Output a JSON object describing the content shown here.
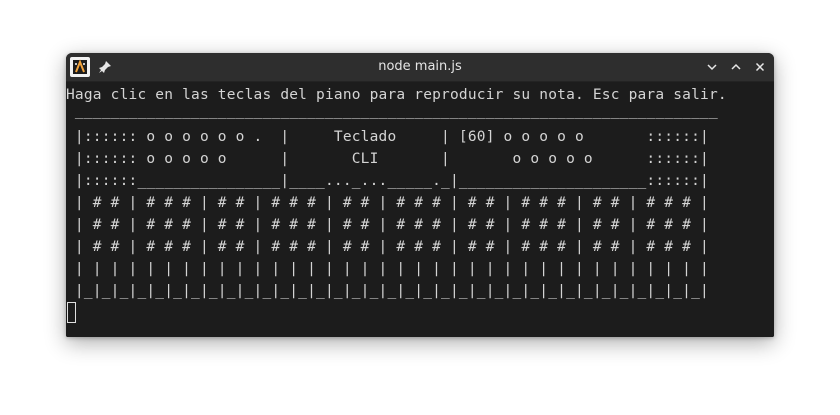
{
  "window": {
    "title": "node main.js",
    "app_icon": "terminal-app-icon",
    "pin_icon": "pin-icon",
    "controls": [
      "minimize-icon",
      "maximize-icon",
      "close-icon"
    ]
  },
  "terminal": {
    "lines": [
      "Haga clic en las teclas del piano para reproducir su nota. Esc para salir.",
      " ________________________________________________________________________",
      " |:::::: o o o o o o .  |     Teclado     | [60] o o o o o       ::::::|",
      " |:::::: o o o o o      |       CLI       |       o o o o o      ::::::|",
      " |::::::________________|____..._..._____._|_____________________::::::|",
      " | # # | # # # | # # | # # # | # # | # # # | # # | # # # | # # | # # # |",
      " | # # | # # # | # # | # # # | # # | # # # | # # | # # # | # # | # # # |",
      " | # # | # # # | # # | # # # | # # | # # # | # # | # # # | # # | # # # |",
      " | | | | | | | | | | | | | | | | | | | | | | | | | | | | | | | | | | | |",
      " |_|_|_|_|_|_|_|_|_|_|_|_|_|_|_|_|_|_|_|_|_|_|_|_|_|_|_|_|_|_|_|_|_|_|_|"
    ]
  },
  "colors": {
    "terminal_bg": "#1c1c1c",
    "titlebar_bg": "#2e2e2e",
    "text": "#d4d4d4"
  }
}
